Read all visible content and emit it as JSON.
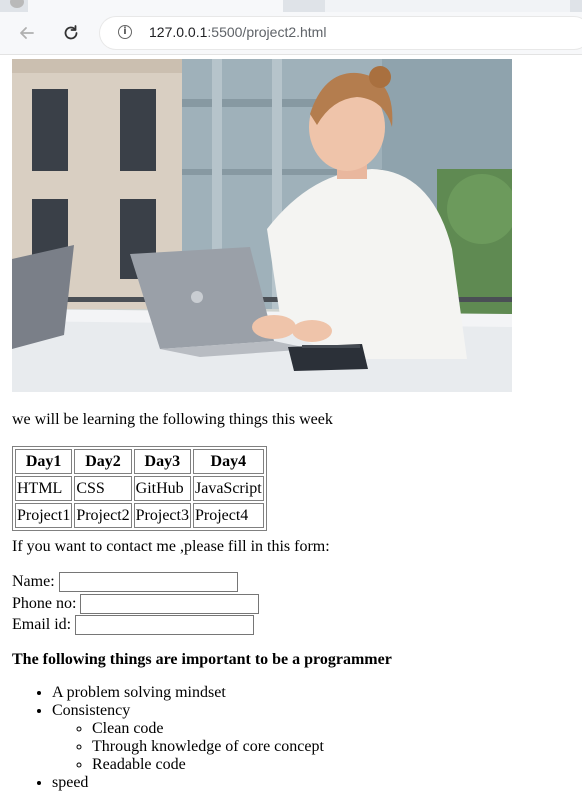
{
  "browser": {
    "url_host": "127.0.0.1",
    "url_path": ":5500/project2.html"
  },
  "page": {
    "intro_text": "we will be learning the following things this week",
    "table": {
      "headers": [
        "Day1",
        "Day2",
        "Day3",
        "Day4"
      ],
      "rows": [
        [
          "HTML",
          "CSS",
          "GitHub",
          "JavaScript"
        ],
        [
          "Project1",
          "Project2",
          "Project3",
          "Project4"
        ]
      ]
    },
    "contact_text": "If you want to contact me ,please fill in this form:",
    "form": {
      "name_label": "Name:",
      "phone_label": "Phone no:",
      "email_label": "Email id:",
      "name_value": "",
      "phone_value": "",
      "email_value": ""
    },
    "heading": "The following things are important to be a programmer",
    "list": {
      "item1": "A problem solving mindset",
      "item2": "Consistency",
      "sub": [
        "Clean code",
        "Through knowledge of core concept",
        "Readable code"
      ],
      "item3": "speed"
    }
  }
}
